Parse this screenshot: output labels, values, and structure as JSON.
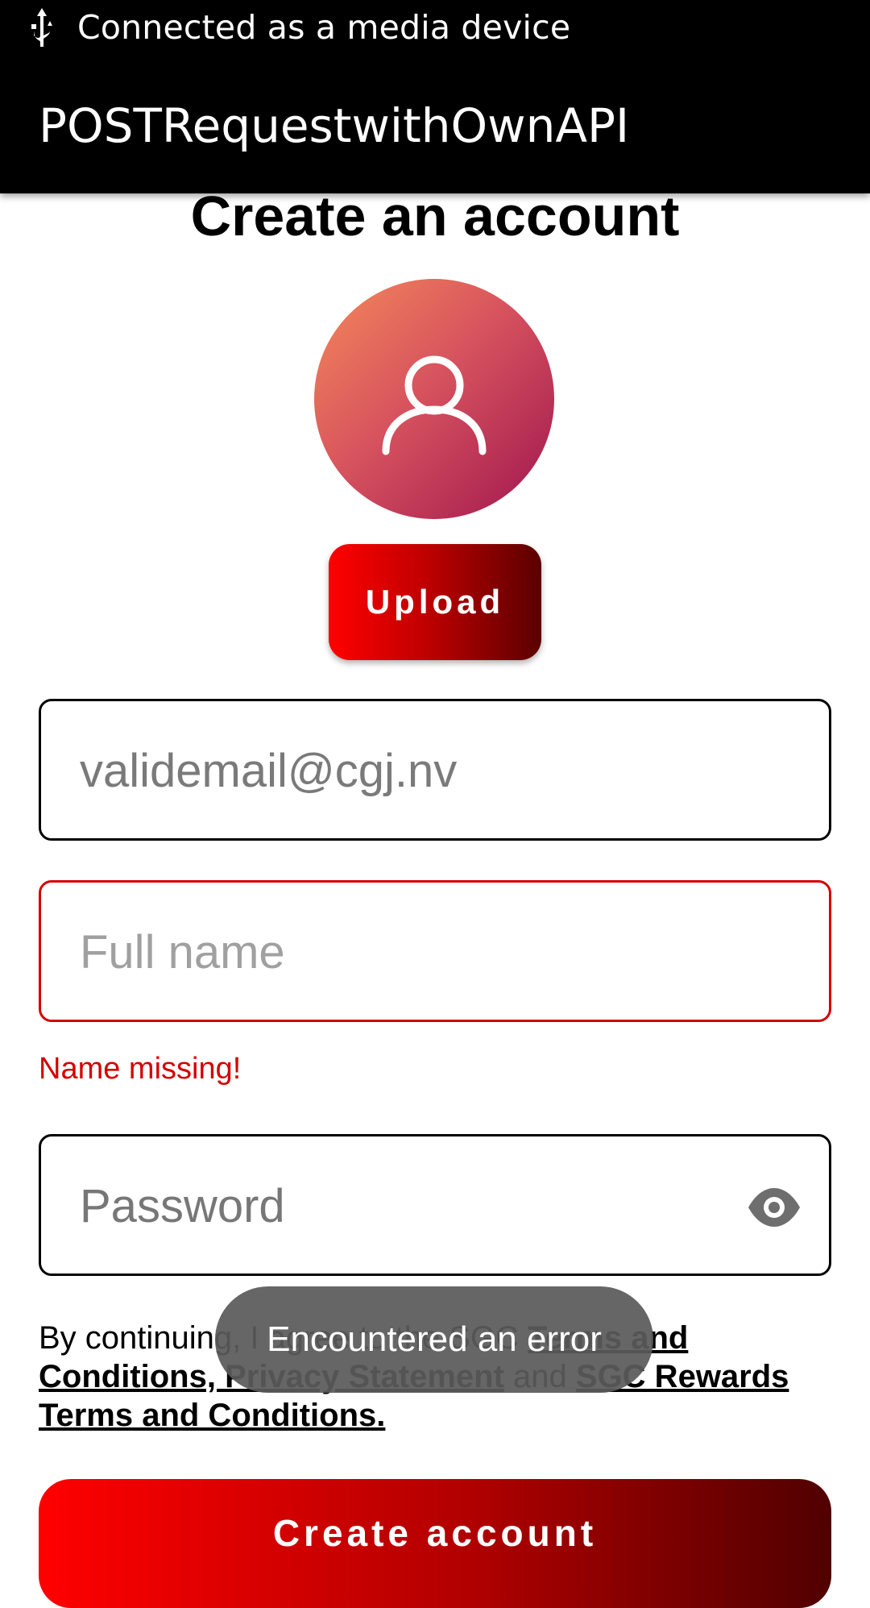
{
  "status_bar": {
    "icon": "usb-icon",
    "text": "Connected as a media device"
  },
  "app_bar": {
    "title": "POSTRequestwithOwnAPI"
  },
  "page": {
    "title": "Create an account"
  },
  "avatar": {
    "icon": "person-outline-icon"
  },
  "upload_button": {
    "label": "Upload"
  },
  "email_field": {
    "value": "validemail@cgj.nv"
  },
  "name_field": {
    "placeholder": "Full name",
    "error": "Name missing!"
  },
  "password_field": {
    "placeholder": "Password",
    "toggle_icon": "eye-icon"
  },
  "terms": {
    "prefix": "By continuing, I agree to the SGC ",
    "link1": "Terms and Conditions, Privacy Statement",
    "middle": " and ",
    "link2": "SGC Rewards Terms and Conditions."
  },
  "toast": {
    "message": "Encountered an error"
  },
  "create_button": {
    "label": "Create account"
  },
  "colors": {
    "accent": "#ff0000",
    "accent_dark": "#500000",
    "error": "#d40000"
  }
}
